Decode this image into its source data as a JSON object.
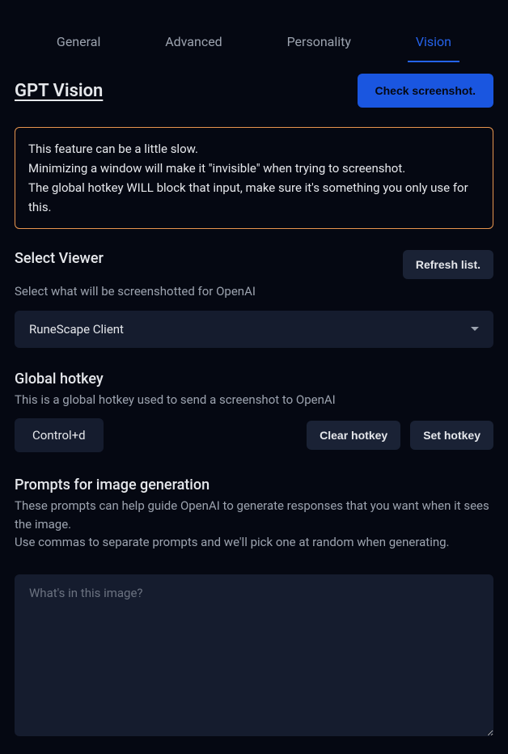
{
  "tabs": {
    "general": "General",
    "advanced": "Advanced",
    "personality": "Personality",
    "vision": "Vision"
  },
  "header": {
    "title": "GPT Vision",
    "check_button": "Check screenshot."
  },
  "info": {
    "line1": "This feature can be a little slow.",
    "line2": "Minimizing a window will make it \"invisible\" when trying to screenshot.",
    "line3": "The global hotkey WILL block that input, make sure it's something you only use for this."
  },
  "viewer": {
    "label": "Select Viewer",
    "desc": "Select what will be screenshotted for OpenAI",
    "refresh_button": "Refresh list.",
    "selected": "RuneScape Client"
  },
  "hotkey": {
    "label": "Global hotkey",
    "desc": "This is a global hotkey used to send a screenshot to OpenAI",
    "value": "Control+d",
    "clear_button": "Clear hotkey",
    "set_button": "Set hotkey"
  },
  "prompts": {
    "label": "Prompts for image generation",
    "desc": "These prompts can help guide OpenAI to generate responses that you want when it sees the image.\nUse commas to separate prompts and we'll pick one at random when generating.",
    "placeholder": "What's in this image?"
  }
}
